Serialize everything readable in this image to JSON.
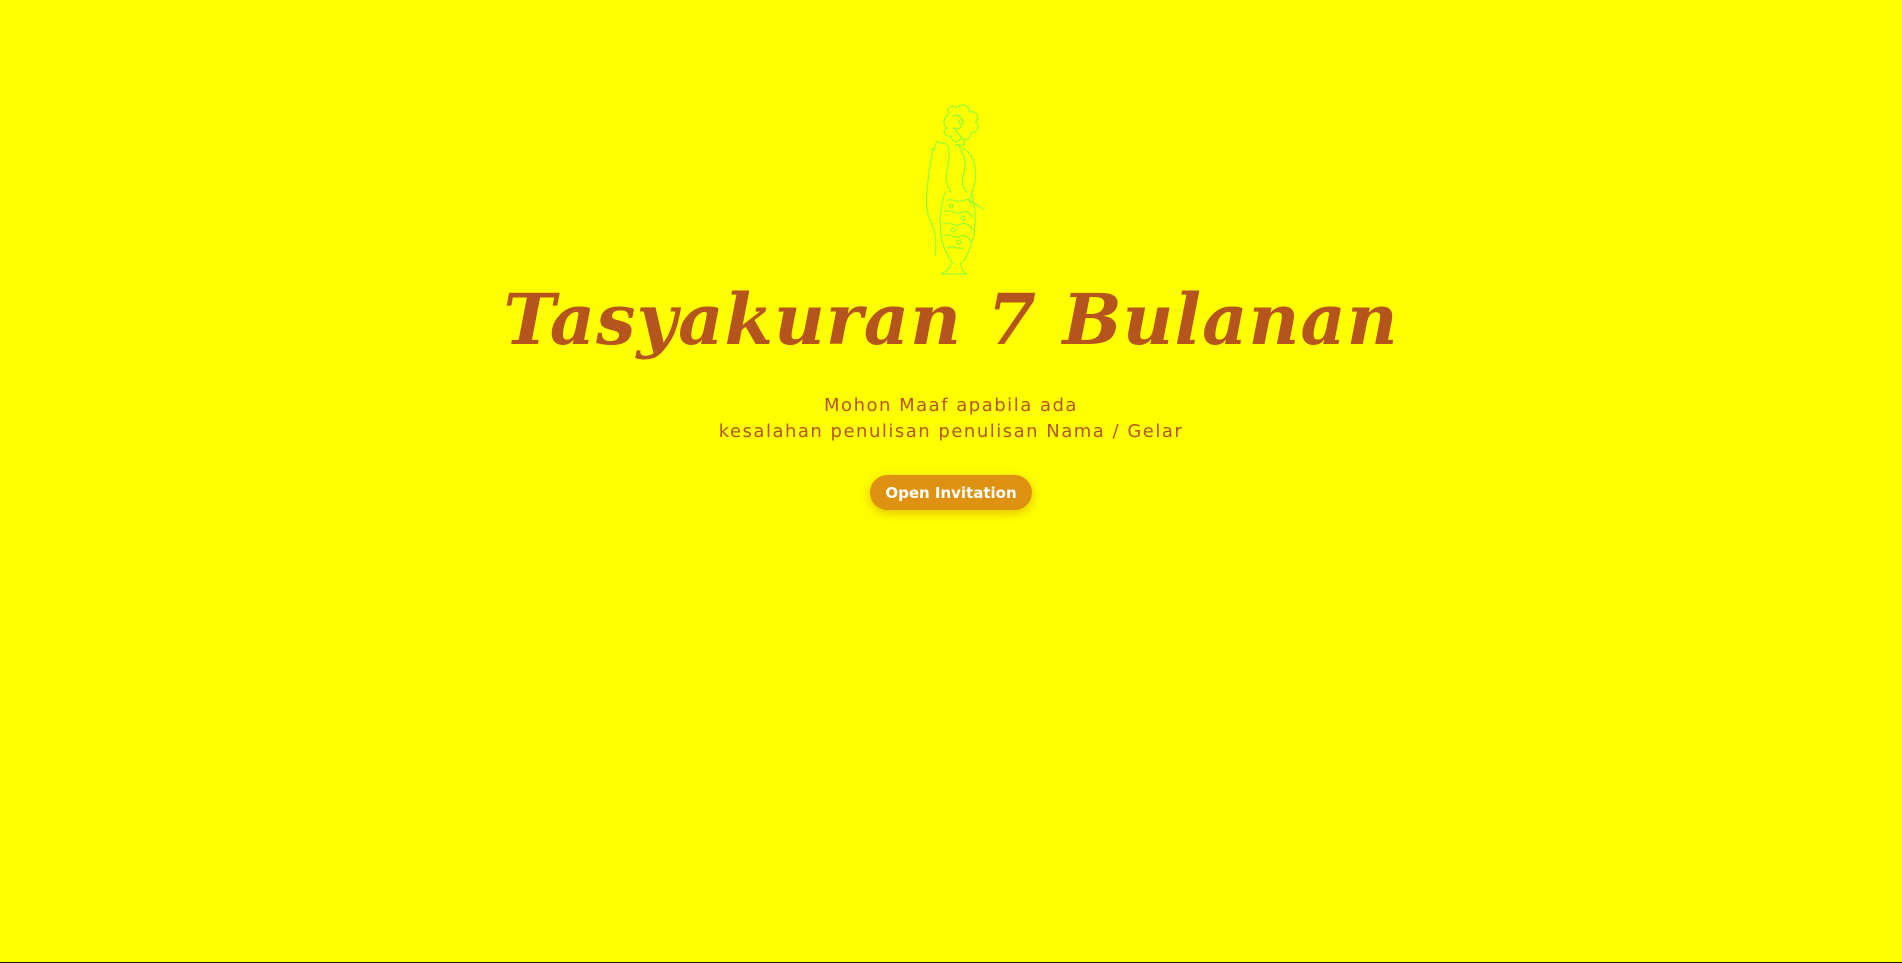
{
  "invitation": {
    "title": "Tasyakuran 7 Bulanan",
    "message_line1": "Mohon Maaf apabila ada",
    "message_line2": "kesalahan penulisan penulisan Nama / Gelar",
    "open_button_label": "Open Invitation"
  },
  "ornament": {
    "icon": "wayang-figure-icon"
  },
  "colors": {
    "background": "#ffff00",
    "title": "#b5541c",
    "text": "#b5541c",
    "button": "#df9212",
    "ornament": "#99ff33"
  }
}
